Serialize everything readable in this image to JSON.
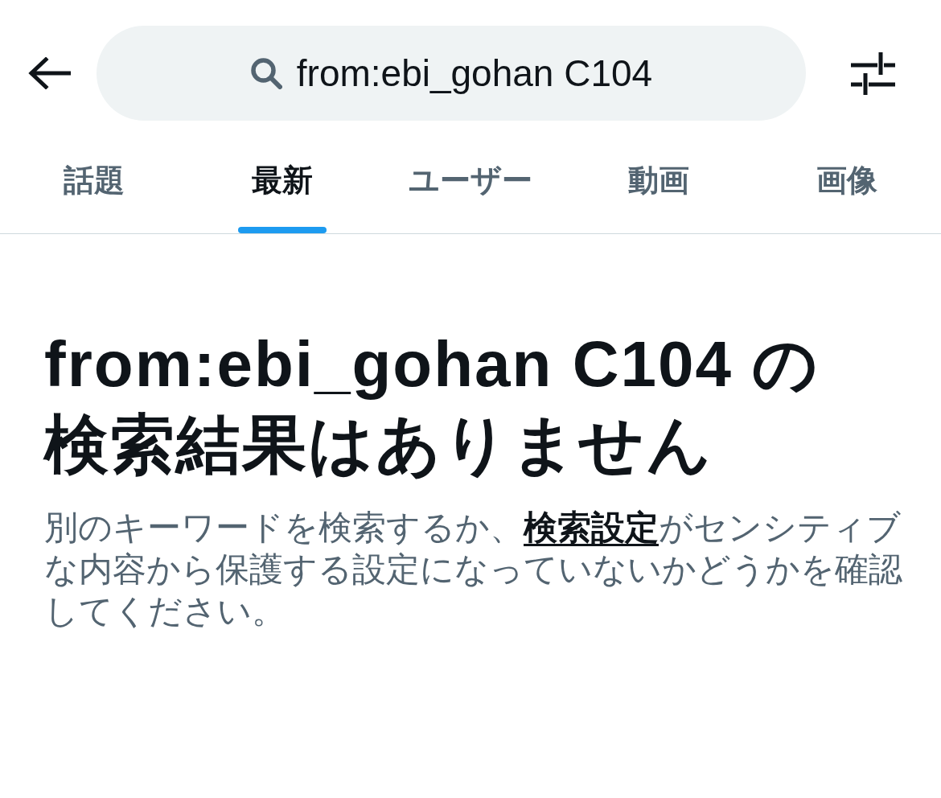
{
  "header": {
    "search": {
      "value": "from:ebi_gohan C104"
    }
  },
  "tabs": [
    {
      "label": "話題",
      "selected": false
    },
    {
      "label": "最新",
      "selected": true
    },
    {
      "label": "ユーザー",
      "selected": false
    },
    {
      "label": "動画",
      "selected": false
    },
    {
      "label": "画像",
      "selected": false
    }
  ],
  "result": {
    "heading": "from:ebi_gohan C104 の検索結果はありません",
    "message": {
      "before": "別のキーワードを検索するか、",
      "link": "検索設定",
      "after": "がセンシティブな内容から保護する設定になっていないかどうかを確認してください。"
    }
  }
}
